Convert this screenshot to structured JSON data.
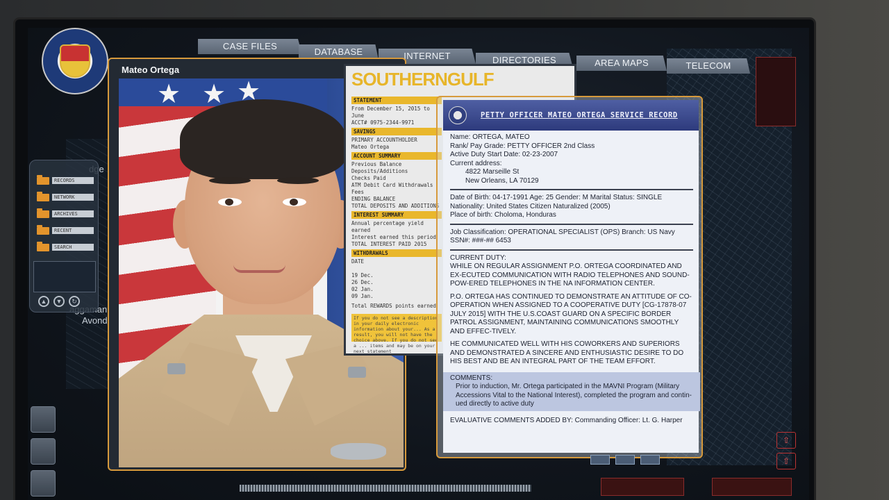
{
  "nav": {
    "tabs": [
      "CASE FILES",
      "DATABASE",
      "INTERNET",
      "DIRECTORIES",
      "AREA MAPS",
      "TELECOM"
    ]
  },
  "sidebar": {
    "items": [
      "RECORDS",
      "NETWORK",
      "ARCHIVES",
      "RECENT",
      "SEARCH"
    ]
  },
  "map": {
    "labels": [
      "dge",
      "aggaman",
      "Avonda"
    ]
  },
  "photo_card": {
    "name": "Mateo Ortega"
  },
  "bank": {
    "logo": "SOUTHERNGULF",
    "sections": {
      "statement": "STATEMENT",
      "statement_text": "From December 15, 2015 to June\nACCT# 0975-2344-9971",
      "savings": "SAVINGS",
      "savings_text": "PRIMARY ACCOUNTHOLDER\nMateo Ortega",
      "account_summary": "ACCOUNT SUMMARY",
      "account_summary_text": "Previous Balance\nDeposits/Additions\nChecks Paid\nATM Debit Card Withdrawals\nFees\nENDING BALANCE\nTOTAL DEPOSITS AND ADDITIONS",
      "interest_summary": "INTEREST SUMMARY",
      "interest_text": "Annual percentage yield earned\nInterest earned this period\nTOTAL INTEREST PAID 2015",
      "withdrawals": "WITHDRAWALS",
      "withdrawals_text": "DATE\n\n19 Dec.\n26 Dec.\n02 Jan.\n09 Jan.",
      "rewards": "Total REWARDS points earned",
      "note": "If you do not see a description in your daily electronic information about your... As a result, you will not have the choice above. If you do not see a ... items and may be on your next statement"
    }
  },
  "record": {
    "title": "PETTY OFFICER MATEO ORTEGA SERVICE RECORD",
    "name_line": "Name: ORTEGA, MATEO",
    "rank_line": "Rank/ Pay Grade: PETTY OFFICER 2nd Class",
    "active_line": "Active Duty Start Date:  02-23-2007",
    "address_label": "Current address:",
    "address_1": "4822 Marseille St",
    "address_2": "New Orleans, LA 70129",
    "dob_line": "Date of Birth: 04-17-1991   Age: 25      Gender: M    Marital Status: SINGLE",
    "nationality_line": "Nationality: United States Citizen Naturalized (2005)",
    "birthplace_line": "Place of birth: Choloma, Honduras",
    "job_line": "Job Classification:  OPERATIONAL SPECIALIST (OPS)    Branch:  US Navy",
    "ssn_line": "SSN#:  ###-## 6453",
    "duty_heading": "CURRENT DUTY:",
    "duty_p1": "WHILE ON REGULAR ASSIGNMENT P.O. ORTEGA COORDINATED AND EX-ECUTED COMMUNICATION WITH RADIO TELEPHONES AND SOUND-POW-ERED TELEPHONES IN THE NA INFORMATION CENTER.",
    "duty_p2": "P.O. ORTEGA HAS CONTINUED TO DEMONSTRATE AN ATTITUDE OF CO-OPERATION WHEN ASSIGNED TO A COOPERATIVE DUTY [CG-17878-07 July 2015]  WITH THE U.S.COAST GUARD ON A SPECIFIC BORDER PATROL ASSIGNMENT, MAINTAINING COMMUNICATIONS SMOOTHLY AND EFFEC-TIVELY.",
    "duty_p3": "HE COMMUNICATED WELL WITH HIS COWORKERS AND SUPERIORS AND DEMONSTRATED A SINCERE AND ENTHUSIASTIC DESIRE TO DO HIS BEST AND BE AN INTEGRAL PART OF THE TEAM EFFORT.",
    "comments_heading": "COMMENTS:",
    "comments_text": "Prior to induction, Mr. Ortega participated in the MAVNI Program (Military Accessions Vital to the National Interest), completed the program and contin-ued directly to active duty",
    "footer": "EVALUATIVE COMMENTS ADDED BY: Commanding Officer:  Lt. G. Harper"
  },
  "colors": {
    "accent_frame": "#d79a3c",
    "record_header": "#2d3a7c",
    "bank_yellow": "#e9b72c"
  }
}
